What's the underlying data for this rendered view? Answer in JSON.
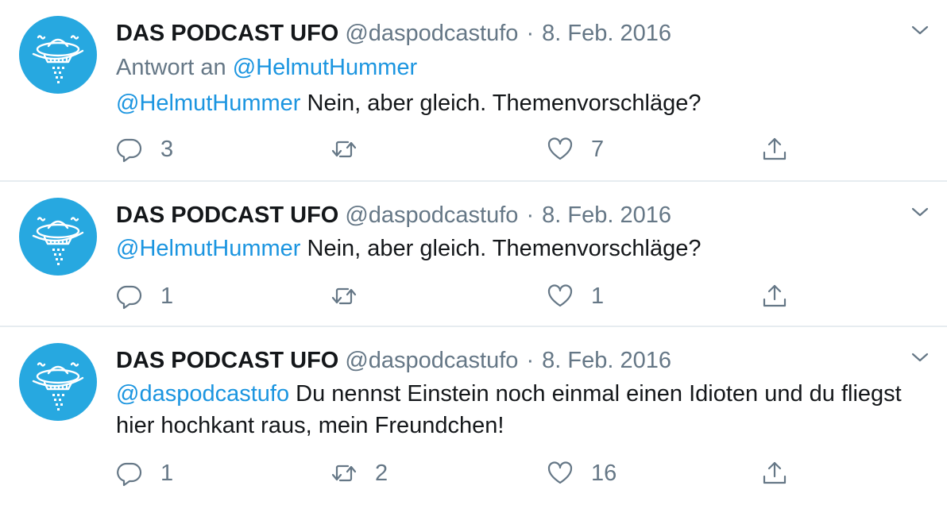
{
  "tweets": [
    {
      "name": "DAS PODCAST UFO",
      "handle": "@daspodcastufo",
      "separator": "·",
      "date": "8. Feb. 2016",
      "reply_prefix": "Antwort an",
      "reply_to": "@HelmutHummer",
      "mention": "@HelmutHummer",
      "text": " Nein, aber gleich. Themenvorschläge?",
      "replies": "3",
      "retweets": "",
      "likes": "7"
    },
    {
      "name": "DAS PODCAST UFO",
      "handle": "@daspodcastufo",
      "separator": "·",
      "date": "8. Feb. 2016",
      "mention": "@HelmutHummer",
      "text": " Nein, aber gleich. Themenvorschläge?",
      "replies": "1",
      "retweets": "",
      "likes": "1"
    },
    {
      "name": "DAS PODCAST UFO",
      "handle": "@daspodcastufo",
      "separator": "·",
      "date": "8. Feb. 2016",
      "mention": "@daspodcastufo",
      "text": " Du nennst Einstein noch einmal einen Idioten und du fliegst hier hochkant raus, mein Freundchen!",
      "replies": "1",
      "retweets": "2",
      "likes": "16"
    }
  ],
  "icons": {
    "avatar": "ufo-logo-icon",
    "menu": "chevron-down-icon",
    "reply": "reply-icon",
    "retweet": "retweet-icon",
    "like": "heart-icon",
    "share": "share-icon"
  },
  "colors": {
    "avatar_bg": "#27a8e0",
    "link": "#1b95e0",
    "muted": "#657786",
    "text": "#14171a",
    "divider": "#e6ecf0"
  }
}
